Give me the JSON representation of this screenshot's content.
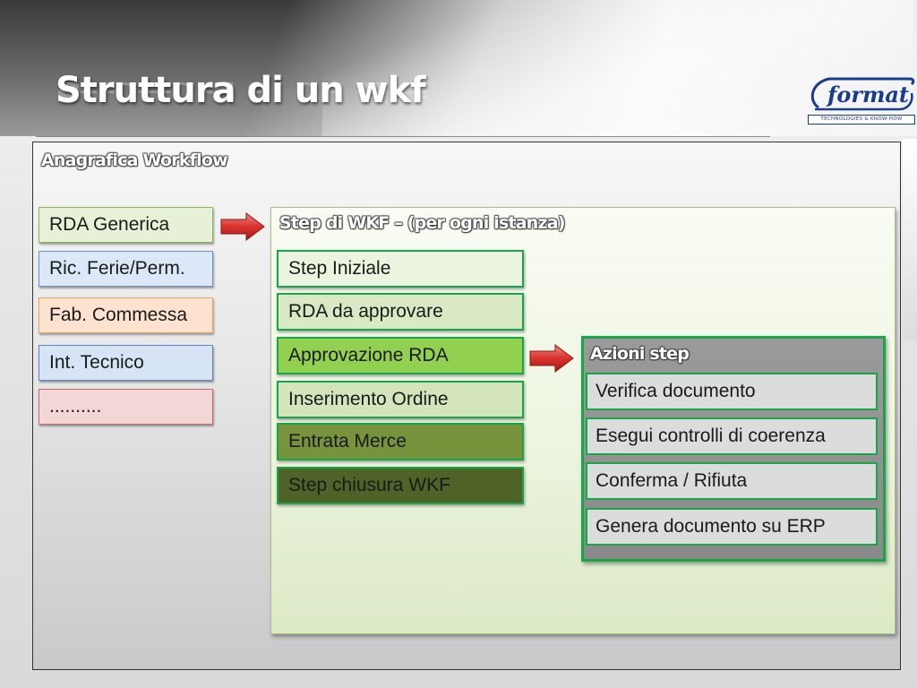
{
  "slide": {
    "title": "Struttura di un wkf"
  },
  "logo": {
    "name": "format",
    "tagline": "TECHNOLOGIES & KNOW-HOW"
  },
  "registry": {
    "title": "Anagrafica Workflow",
    "items": [
      {
        "label": "RDA Generica",
        "color": "#e7f1d8",
        "border": "#8fb45a"
      },
      {
        "label": "Ric. Ferie/Perm.",
        "color": "#dbe8f7",
        "border": "#6f93c6"
      },
      {
        "label": "Fab. Commessa",
        "color": "#fde3cf",
        "border": "#e8a86a"
      },
      {
        "label": "Int. Tecnico",
        "color": "#d6e4f5",
        "border": "#5f86bf"
      },
      {
        "label": "..........",
        "color": "#f3d6d6",
        "border": "#c96a6a"
      }
    ]
  },
  "steps": {
    "title": "Step di  WKF – (per ogni istanza)",
    "items": [
      {
        "label": "Step Iniziale",
        "color": "#ebf4df",
        "text_color": "#1a1a1a"
      },
      {
        "label": "RDA da approvare",
        "color": "#d9e9c3",
        "text_color": "#1a1a1a"
      },
      {
        "label": "Approvazione RDA",
        "color": "#92d050",
        "text_color": "#1a1a1a"
      },
      {
        "label": "Inserimento Ordine",
        "color": "#d4e5bc",
        "text_color": "#1a1a1a"
      },
      {
        "label": "Entrata Merce",
        "color": "#77933c",
        "text_color": "#1a1a1a"
      },
      {
        "label": "Step chiusura WKF",
        "color": "#4f6228",
        "text_color": "#1a1a1a"
      }
    ]
  },
  "actions": {
    "title": "Azioni step",
    "items": [
      {
        "label": "Verifica documento"
      },
      {
        "label": "Esegui controlli di coerenza"
      },
      {
        "label": "Conferma / Rifiuta"
      },
      {
        "label": "Genera documento su ERP"
      }
    ]
  },
  "colors": {
    "accent_green": "#19a64a",
    "arrow_red": "#d9312c"
  }
}
